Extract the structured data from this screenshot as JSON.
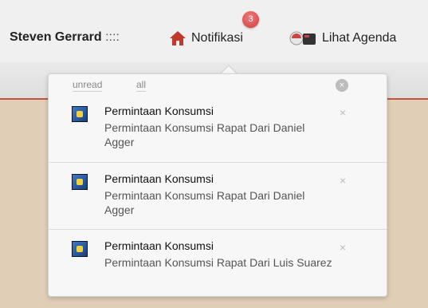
{
  "header": {
    "user_name": "Steven Gerrard",
    "separator": "::::",
    "notifications_label": "Notifikasi",
    "notifications_count": "3",
    "agenda_label": "Lihat Agenda"
  },
  "popup": {
    "filter_unread": "unread",
    "filter_all": "all",
    "close_all": "×",
    "items": [
      {
        "title": "Permintaan Konsumsi",
        "desc": "Permintaan Konsumsi Rapat Dari Daniel Agger",
        "close": "×"
      },
      {
        "title": "Permintaan Konsumsi",
        "desc": "Permintaan Konsumsi Rapat Dari Daniel Agger",
        "close": "×"
      },
      {
        "title": "Permintaan Konsumsi",
        "desc": "Permintaan Konsumsi Rapat Dari Luis Suarez",
        "close": "×"
      }
    ]
  },
  "colors": {
    "accent": "#c0553f",
    "badge": "#d43c3c",
    "home_icon": "#c0392b"
  },
  "icons": {
    "notifications": "home-icon",
    "agenda": "agenda-icon",
    "item_thumb": "twitter-bird-icon"
  }
}
